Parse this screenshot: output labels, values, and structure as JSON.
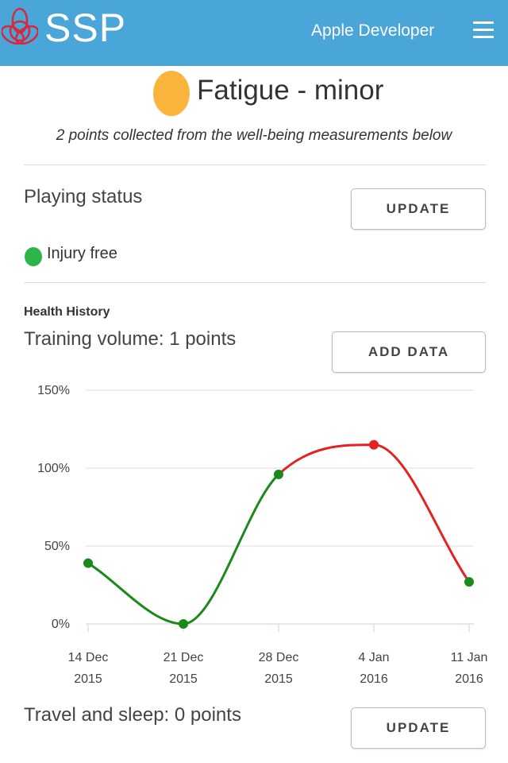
{
  "header": {
    "app_name": "SSP",
    "developer_label": "Apple Developer",
    "logo_icon": "triquetra-icon",
    "menu_icon": "hamburger-menu-icon",
    "background_color": "#4aa5d8"
  },
  "fatigue": {
    "level_color": "#f8b43b",
    "title": "Fatigue - minor",
    "subtitle": "2 points collected from the well-being measurements below"
  },
  "playing_status": {
    "title": "Playing status",
    "update_label": "UPDATE",
    "status_label": "Injury free",
    "status_color": "#2db54a"
  },
  "health_history": {
    "heading": "Health History",
    "training_volume_title": "Training volume: 1 points",
    "add_data_label": "ADD DATA",
    "travel_sleep_title": "Travel and sleep: 0 points",
    "travel_update_label": "UPDATE"
  },
  "chart_data": {
    "type": "line",
    "title": "",
    "xlabel": "",
    "ylabel": "",
    "categories": [
      "14 Dec 2015",
      "21 Dec 2015",
      "28 Dec 2015",
      "4 Jan 2016",
      "11 Jan 2016"
    ],
    "x_tick_lines": [
      [
        "14 Dec",
        "2015"
      ],
      [
        "21 Dec",
        "2015"
      ],
      [
        "28 Dec",
        "2015"
      ],
      [
        "4 Jan",
        "2016"
      ],
      [
        "11 Jan",
        "2016"
      ]
    ],
    "y_ticks": [
      "0%",
      "50%",
      "100%",
      "150%"
    ],
    "ylim": [
      0,
      150
    ],
    "series": [
      {
        "values": [
          39,
          0,
          96,
          115,
          27
        ]
      }
    ],
    "point_colors": [
      "#1a8a1a",
      "#1a8a1a",
      "#1a8a1a",
      "#e52222",
      "#1a8a1a"
    ],
    "line_color_normal": "#1a8a1a",
    "line_color_over_100": "#e52222",
    "grid": true
  }
}
